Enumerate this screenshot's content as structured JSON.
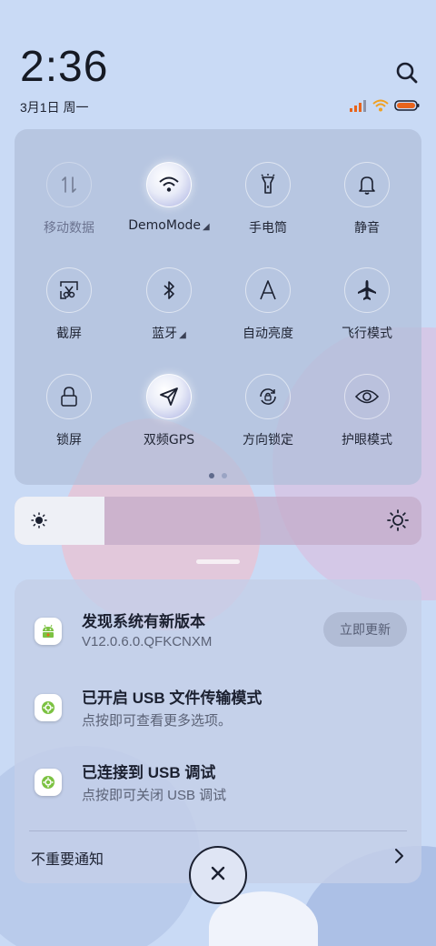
{
  "status_bar": {
    "time": "2:36",
    "date": "3月1日 周一"
  },
  "quick_settings": {
    "tiles": [
      {
        "label": "移动数据",
        "icon": "mobile-data-icon",
        "state": "off"
      },
      {
        "label": "DemoMode",
        "icon": "wifi-icon",
        "state": "on",
        "expand": "◢"
      },
      {
        "label": "手电筒",
        "icon": "flashlight-icon",
        "state": "normal"
      },
      {
        "label": "静音",
        "icon": "bell-icon",
        "state": "normal"
      },
      {
        "label": "截屏",
        "icon": "screenshot-icon",
        "state": "normal"
      },
      {
        "label": "蓝牙",
        "icon": "bluetooth-icon",
        "state": "normal",
        "expand": "◢"
      },
      {
        "label": "自动亮度",
        "icon": "auto-brightness-icon",
        "state": "normal"
      },
      {
        "label": "飞行模式",
        "icon": "airplane-icon",
        "state": "normal"
      },
      {
        "label": "锁屏",
        "icon": "lock-icon",
        "state": "normal"
      },
      {
        "label": "双频GPS",
        "icon": "gps-icon",
        "state": "on"
      },
      {
        "label": "方向锁定",
        "icon": "rotation-lock-icon",
        "state": "normal"
      },
      {
        "label": "护眼模式",
        "icon": "eye-icon",
        "state": "normal"
      }
    ],
    "pages": 2,
    "current_page": 1
  },
  "brightness": {
    "level": 0.22
  },
  "notifications": [
    {
      "title": "发现系统有新版本",
      "subtitle": "V12.0.6.0.QFKCNXM",
      "icon": "android-update-icon",
      "action": "立即更新"
    },
    {
      "title": "已开启 USB 文件传输模式",
      "subtitle": "点按即可查看更多选项。",
      "icon": "android-settings-icon"
    },
    {
      "title": "已连接到 USB 调试",
      "subtitle": "点按即可关闭 USB 调试",
      "icon": "android-settings-icon"
    }
  ],
  "footer": {
    "label": "不重要通知"
  },
  "colors": {
    "background": "#c9daf5",
    "panel": "#b0beda",
    "accent_green": "#7cc242",
    "battery": "#e8641c",
    "wifi": "#f0a020"
  }
}
